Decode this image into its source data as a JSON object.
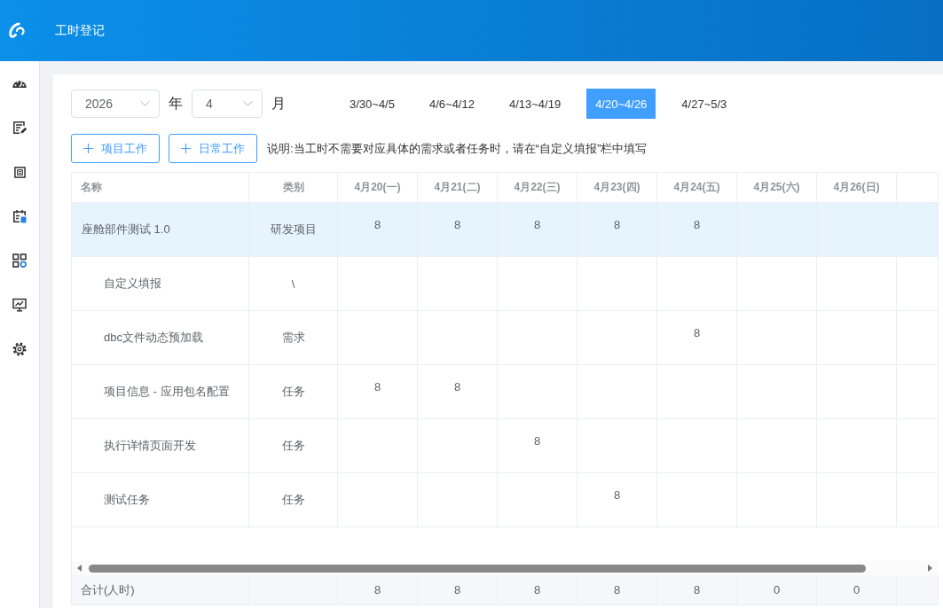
{
  "header": {
    "title": "工时登记"
  },
  "filters": {
    "year": {
      "value": "2026",
      "unit": "年"
    },
    "month": {
      "value": "4",
      "unit": "月"
    },
    "weeks": [
      {
        "label": "3/30~4/5",
        "selected": false
      },
      {
        "label": "4/6~4/12",
        "selected": false
      },
      {
        "label": "4/13~4/19",
        "selected": false
      },
      {
        "label": "4/20~4/26",
        "selected": true
      },
      {
        "label": "4/27~5/3",
        "selected": false
      }
    ]
  },
  "actions": [
    {
      "label": "项目工作"
    },
    {
      "label": "日常工作"
    }
  ],
  "note": "说明:当工时不需要对应具体的需求或者任务时，请在“自定义填报”栏中填写",
  "table": {
    "columns": [
      "名称",
      "类别",
      "4月20(一)",
      "4月21(二)",
      "4月22(三)",
      "4月23(四)",
      "4月24(五)",
      "4月25(六)",
      "4月26(日)"
    ],
    "rows": [
      {
        "name": "座舱部件测试 1.0",
        "category": "研发项目",
        "hours": {
          "mon": "8",
          "tue": "8",
          "wed": "8",
          "thu": "8",
          "fri": "8"
        },
        "selected": true,
        "children": [
          {
            "name": "自定义填报",
            "category": "\\",
            "selected": false
          },
          {
            "name": "dbc文件动态预加载",
            "category": "需求",
            "hours": {
              "fri": "8"
            },
            "selected": false
          },
          {
            "name": "项目信息 - 应用包名配置",
            "category": "任务",
            "hours": {
              "mon": "8",
              "tue": "8"
            },
            "selected": false
          },
          {
            "name": "执行详情页面开发",
            "category": "任务",
            "hours": {
              "wed": "8"
            },
            "selected": false
          },
          {
            "name": "测试任务",
            "category": "任务",
            "hours": {
              "thu": "8"
            },
            "selected": false
          }
        ]
      }
    ],
    "footer": {
      "label": "合计(人时)",
      "values": [
        "8",
        "8",
        "8",
        "8",
        "8",
        "0",
        "0"
      ]
    }
  }
}
